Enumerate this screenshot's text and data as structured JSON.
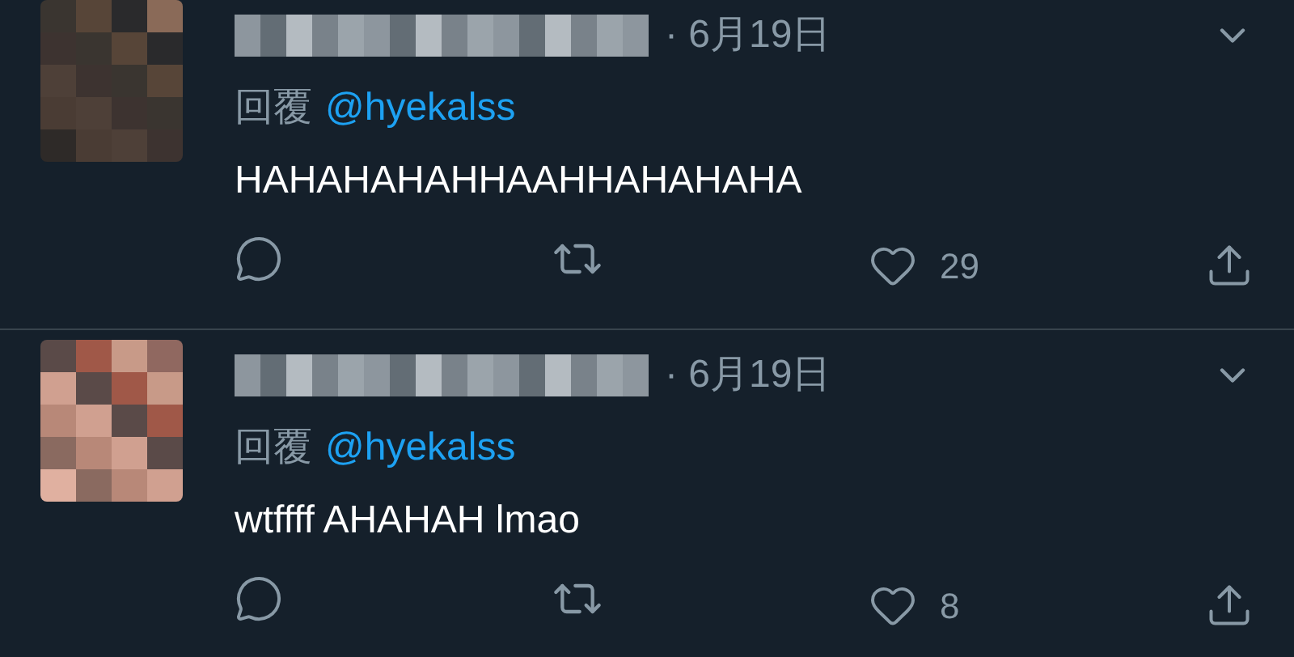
{
  "tweets": [
    {
      "date": "· 6月19日",
      "reply_label": "回覆",
      "reply_handle": "@hyekalss",
      "text": "HAHAHAHAHHAAHHAHAHAHA",
      "likes": "29"
    },
    {
      "date": "· 6月19日",
      "reply_label": "回覆",
      "reply_handle": "@hyekalss",
      "text": "wtffff AHAHAH lmao",
      "likes": "8"
    }
  ]
}
